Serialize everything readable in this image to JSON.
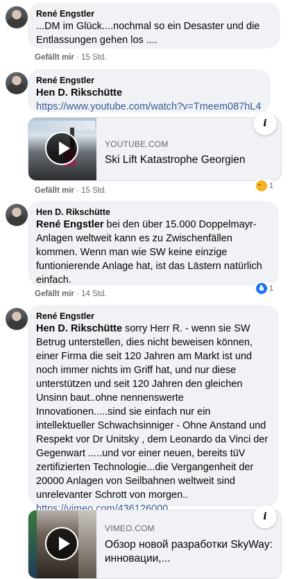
{
  "comments": [
    {
      "author": "René Engstler",
      "text": "...DM im Glück....nochmal so ein Desaster und die Entlassungen gehen los ....",
      "like_label": "Gefällt mir",
      "separator": " · ",
      "time": "15 Std."
    },
    {
      "author": "René Engstler",
      "mention": "Hen D. Rikschütte",
      "link": "https://www.youtube.com/watch?v=Tmeem087hL4",
      "card": {
        "domain": "YOUTUBE.COM",
        "title": "Ski Lift Katastrophe Georgien",
        "info_icon": "info-icon"
      },
      "like_label": "Gefällt mir",
      "separator": " · ",
      "time": "15 Std.",
      "reaction": {
        "icon": "sad-emoji",
        "count": "1"
      }
    },
    {
      "author": "Hen D. Rikschütte",
      "mention": "René Engstler",
      "text": " bei den über 15.000 Doppelmayr-Anlagen weltweit kann es zu Zwischenfällen kommen. Wenn man wie SW keine einzige funtionierende Anlage hat, ist das Lästern natürlich einfach.",
      "like_label": "Gefällt mir",
      "separator": " · ",
      "time": "14 Std.",
      "reaction": {
        "icon": "like-thumb",
        "count": "1"
      }
    },
    {
      "author": "René Engstler",
      "mention": "Hen D. Rikschütte",
      "text": " sorry Herr R. - wenn sie SW Betrug unterstellen, dies nicht beweisen können, einer Firma die seit 120 Jahren am Markt ist und noch immer nichts im Griff hat, und nur diese unterstützen und seit 120 Jahren den gleichen Unsinn baut..ohne nennenswerte Innovationen.....sind sie einfach nur ein intellektueller Schwachsinniger - Ohne Anstand und Respekt vor Dr Unitsky , dem Leonardo da Vinci der Gegenwart .....und vor einer neuen, bereits tüV zertifizierten Technologie...die Vergangenheit der 20000 Anlagen von Seilbahnen weltweit sind unrelevanter Schrott von morgen..",
      "link": "https://vimeo.com/436126000",
      "card": {
        "domain": "VIMEO.COM",
        "title": "Обзор новой разработки SkyWay: инновации,...",
        "info_icon": "info-icon"
      }
    }
  ],
  "colors": {
    "bubble": "#f0f2f5",
    "link": "#385898",
    "meta": "#65676b",
    "like_blue": "#1877f2"
  }
}
